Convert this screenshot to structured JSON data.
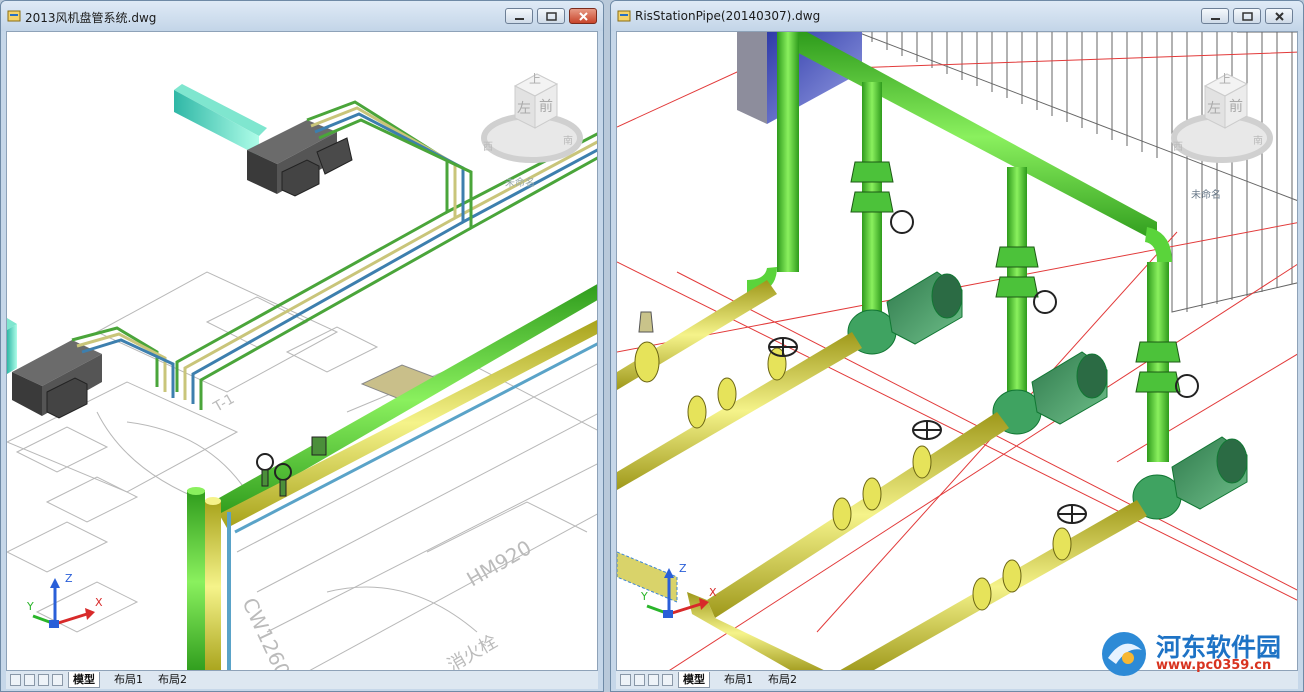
{
  "left_window": {
    "title": "2013风机盘管系统.dwg",
    "viewcube": {
      "top": "上",
      "left": "左",
      "front": "前",
      "west": "西",
      "south": "南"
    },
    "view_name": "未命名",
    "tabs": [
      "模型",
      "布局1",
      "布局2"
    ],
    "drawing_text": {
      "label_hm": "HM920",
      "label_cw": "CW1260",
      "label_fire": "消火栓",
      "label_t": "T-1"
    }
  },
  "right_window": {
    "title": "RisStationPipe(20140307).dwg",
    "viewcube": {
      "top": "上",
      "left": "左",
      "front": "前",
      "west": "西",
      "south": "南"
    },
    "view_name": "未命名",
    "tabs": [
      "模型",
      "布局1",
      "布局2"
    ]
  },
  "ucs": {
    "x": "X",
    "y": "Y",
    "z": "Z"
  },
  "watermark": {
    "title": "河东软件园",
    "url": "www.pc0359.cn"
  },
  "colors": {
    "pipe_green": "#5ad43b",
    "pipe_yellow": "#e6e35a",
    "grid_red": "#e23a3a",
    "title_bg": "#c6d7e9"
  }
}
